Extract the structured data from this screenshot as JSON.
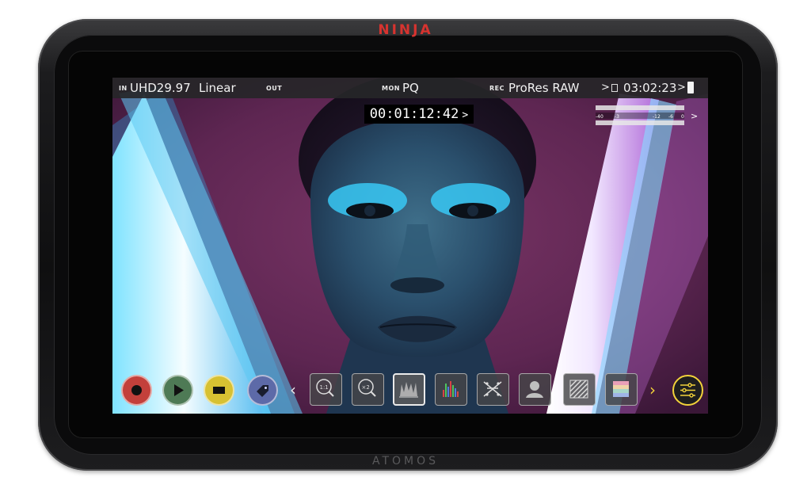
{
  "device": {
    "brand": "NINJA",
    "maker": "ATOMOS"
  },
  "topbar": {
    "in_label": "IN",
    "in_value": "UHD29.97",
    "in_gamma": "Linear",
    "out_label": "OUT",
    "mon_label": "MON",
    "mon_value": "PQ",
    "rec_label": "REC",
    "rec_value": "ProRes RAW",
    "remaining_time": "03:02:23"
  },
  "timecode": "00:01:12:42",
  "audio_meters": {
    "scale_labels": [
      "-40",
      "-3",
      "-12",
      "-6",
      "0"
    ]
  },
  "controls": {
    "record": "record-icon",
    "play": "play-icon",
    "stop": "stop-icon",
    "tag": "tag-icon",
    "tools": [
      "zoom-1-1-icon",
      "zoom-x2-icon",
      "waveform-icon",
      "histogram-icon",
      "false-color-icon",
      "face-icon",
      "zebra-icon",
      "color-bars-icon"
    ],
    "menu": "settings-sliders-icon"
  },
  "colors": {
    "record": "#c3403b",
    "play": "#4e7a55",
    "stop": "#d7c132",
    "tag": "#5d6aa8",
    "brand": "#d7332f",
    "menu_accent": "#f2d23a"
  }
}
